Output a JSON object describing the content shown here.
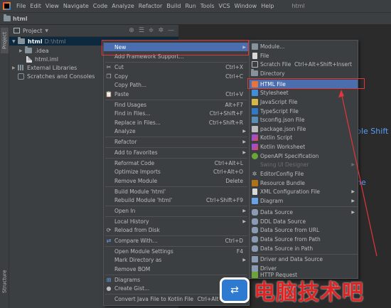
{
  "menubar": {
    "items": [
      "File",
      "Edit",
      "View",
      "Navigate",
      "Code",
      "Analyze",
      "Refactor",
      "Build",
      "Run",
      "Tools",
      "VCS",
      "Window",
      "Help"
    ],
    "window_title": "html"
  },
  "navbar": {
    "project": "html"
  },
  "stripe": {
    "project_tab": "Project",
    "structure_tab": "Structure"
  },
  "tool_window": {
    "title": "Project"
  },
  "tree": {
    "root_name": "html",
    "root_path": "D:\\html",
    "idea": ".idea",
    "iml": "html.iml",
    "ext_libs": "External Libraries",
    "scratches": "Scratches and Consoles"
  },
  "editor": {
    "hint1": "ble Shift",
    "hint2": "ne"
  },
  "context_menu": [
    {
      "label": "New",
      "shortcut": "",
      "submenu": true
    },
    {
      "label": "Add Framework Support...",
      "shortcut": ""
    },
    {
      "label": "Cut",
      "shortcut": "Ctrl+X"
    },
    {
      "label": "Copy",
      "shortcut": "Ctrl+C"
    },
    {
      "label": "Copy Path...",
      "shortcut": ""
    },
    {
      "label": "Paste",
      "shortcut": "Ctrl+V"
    },
    {
      "label": "Find Usages",
      "shortcut": "Alt+F7"
    },
    {
      "label": "Find in Files...",
      "shortcut": "Ctrl+Shift+F"
    },
    {
      "label": "Replace in Files...",
      "shortcut": "Ctrl+Shift+R"
    },
    {
      "label": "Analyze",
      "shortcut": "",
      "submenu": true
    },
    {
      "label": "Refactor",
      "shortcut": "",
      "submenu": true
    },
    {
      "label": "Add to Favorites",
      "shortcut": "",
      "submenu": true
    },
    {
      "label": "Reformat Code",
      "shortcut": "Ctrl+Alt+L"
    },
    {
      "label": "Optimize Imports",
      "shortcut": "Ctrl+Alt+O"
    },
    {
      "label": "Remove Module",
      "shortcut": "Delete"
    },
    {
      "label": "Build Module 'html'",
      "shortcut": ""
    },
    {
      "label": "Rebuild Module 'html'",
      "shortcut": "Ctrl+Shift+F9"
    },
    {
      "label": "Open In",
      "shortcut": "",
      "submenu": true
    },
    {
      "label": "Local History",
      "shortcut": "",
      "submenu": true
    },
    {
      "label": "Reload from Disk",
      "shortcut": ""
    },
    {
      "label": "Compare With...",
      "shortcut": "Ctrl+D"
    },
    {
      "label": "Open Module Settings",
      "shortcut": "F4"
    },
    {
      "label": "Mark Directory as",
      "shortcut": "",
      "submenu": true
    },
    {
      "label": "Remove BOM",
      "shortcut": ""
    },
    {
      "label": "Diagrams",
      "shortcut": "",
      "submenu": true
    },
    {
      "label": "Create Gist...",
      "shortcut": ""
    },
    {
      "label": "Convert Java File to Kotlin File",
      "shortcut": "Ctrl+Alt+Shift+K"
    }
  ],
  "submenu": [
    {
      "label": "Module...",
      "shortcut": ""
    },
    {
      "label": "File",
      "shortcut": ""
    },
    {
      "label": "Scratch File",
      "shortcut": "Ctrl+Alt+Shift+Insert"
    },
    {
      "label": "Directory",
      "shortcut": ""
    },
    {
      "label": "HTML File",
      "shortcut": ""
    },
    {
      "label": "Stylesheet",
      "shortcut": ""
    },
    {
      "label": "JavaScript File",
      "shortcut": ""
    },
    {
      "label": "TypeScript File",
      "shortcut": ""
    },
    {
      "label": "tsconfig.json File",
      "shortcut": ""
    },
    {
      "label": "package.json File",
      "shortcut": ""
    },
    {
      "label": "Kotlin Script",
      "shortcut": ""
    },
    {
      "label": "Kotlin Worksheet",
      "shortcut": ""
    },
    {
      "label": "OpenAPI Specification",
      "shortcut": ""
    },
    {
      "label": "Swing UI Designer",
      "shortcut": ""
    },
    {
      "label": "EditorConfig File",
      "shortcut": ""
    },
    {
      "label": "Resource Bundle",
      "shortcut": ""
    },
    {
      "label": "XML Configuration File",
      "shortcut": ""
    },
    {
      "label": "Diagram",
      "shortcut": ""
    },
    {
      "label": "Data Source",
      "shortcut": ""
    },
    {
      "label": "DDL Data Source",
      "shortcut": ""
    },
    {
      "label": "Data Source from URL",
      "shortcut": ""
    },
    {
      "label": "Data Source from Path",
      "shortcut": ""
    },
    {
      "label": "Data Source in Path",
      "shortcut": ""
    },
    {
      "label": "Driver and Data Source",
      "shortcut": ""
    },
    {
      "label": "Driver",
      "shortcut": ""
    },
    {
      "label": "HTTP Request",
      "shortcut": ""
    }
  ],
  "watermark": {
    "text": "电脑技术吧"
  },
  "colors": {
    "highlight": "#4b6eaf",
    "annotation": "#e3353a",
    "link": "#589df6"
  }
}
